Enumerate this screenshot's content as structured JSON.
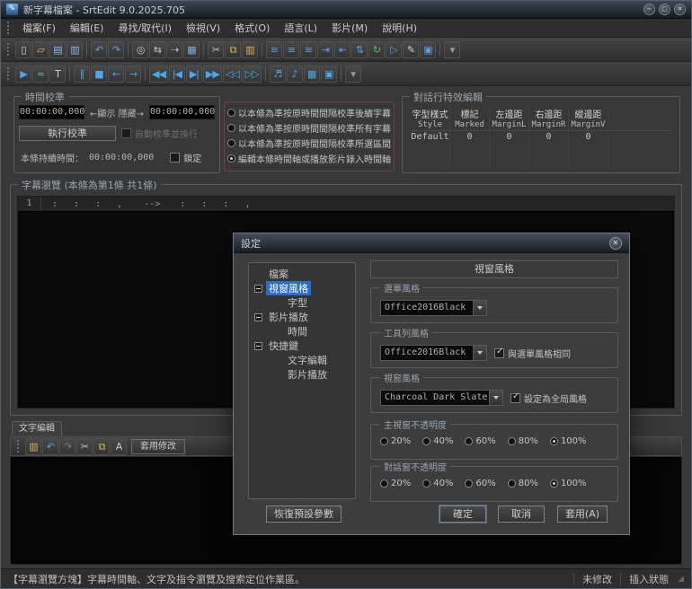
{
  "colors": {
    "selection_blue": "#2a6cc8",
    "icon_blue": "#4aa8e8",
    "titlebar_top": "#3e4754",
    "field_black": "#000000"
  },
  "window": {
    "title": "新字幕檔案 - SrtEdit 9.0.2025.705",
    "icon_glyph": "✎",
    "controls": [
      {
        "name": "minimize-button",
        "glyph": "−"
      },
      {
        "name": "maximize-button",
        "glyph": "□"
      },
      {
        "name": "close-button",
        "glyph": "✕"
      }
    ]
  },
  "menubar": {
    "items": [
      {
        "name": "menu-file",
        "label": "檔案(F)"
      },
      {
        "name": "menu-edit",
        "label": "編輯(E)"
      },
      {
        "name": "menu-find-replace",
        "label": "尋找/取代(I)"
      },
      {
        "name": "menu-view",
        "label": "檢視(V)"
      },
      {
        "name": "menu-format",
        "label": "格式(O)"
      },
      {
        "name": "menu-language",
        "label": "語言(L)"
      },
      {
        "name": "menu-movie",
        "label": "影片(M)"
      },
      {
        "name": "menu-help",
        "label": "說明(H)"
      }
    ]
  },
  "toolbar_main": {
    "icons": [
      {
        "name": "new-file-icon",
        "glyph": "▯",
        "color": "#dcdfe3"
      },
      {
        "name": "open-folder-icon",
        "glyph": "▱",
        "color": "#d8b85a"
      },
      {
        "name": "save-icon",
        "glyph": "▤",
        "color": "#8fb8e8"
      },
      {
        "name": "save-as-icon",
        "glyph": "▥",
        "color": "#8fb8e8"
      },
      {
        "sep": "true"
      },
      {
        "name": "undo-icon",
        "glyph": "↶",
        "color": "#6aa0e0"
      },
      {
        "name": "redo-icon",
        "glyph": "↷",
        "color": "#6aa0e0"
      },
      {
        "sep": "true"
      },
      {
        "name": "find-icon",
        "glyph": "◎",
        "color": "#c8c8c8"
      },
      {
        "name": "replace-icon",
        "glyph": "⇆",
        "color": "#c8c8c8"
      },
      {
        "name": "find-next-icon",
        "glyph": "⇢",
        "color": "#c8c8c8"
      },
      {
        "name": "video-preview-icon",
        "glyph": "▦",
        "color": "#7fb0d8"
      },
      {
        "sep": "true"
      },
      {
        "name": "cut-icon",
        "glyph": "✂",
        "color": "#c8c8c8"
      },
      {
        "name": "copy-icon",
        "glyph": "⧉",
        "color": "#d8b85a"
      },
      {
        "name": "paste-icon",
        "glyph": "▥",
        "color": "#d8b85a"
      },
      {
        "sep": "true"
      },
      {
        "name": "align-left-icon",
        "glyph": "≡",
        "color": "#5a9fe0"
      },
      {
        "name": "align-center-icon",
        "glyph": "≡",
        "color": "#5a9fe0"
      },
      {
        "name": "align-right-icon",
        "glyph": "≡",
        "color": "#5a9fe0"
      },
      {
        "name": "indent-icon",
        "glyph": "⇥",
        "color": "#5a9fe0"
      },
      {
        "name": "outdent-icon",
        "glyph": "⇤",
        "color": "#5a9fe0"
      },
      {
        "name": "sort-icon",
        "glyph": "⇅",
        "color": "#5a9fe0"
      },
      {
        "name": "refresh-icon",
        "glyph": "↻",
        "color": "#5ac06a"
      },
      {
        "name": "play-doc-icon",
        "glyph": "▷",
        "color": "#5a9fe0"
      },
      {
        "name": "edit-pencil-icon",
        "glyph": "✎",
        "color": "#d0d0d0"
      },
      {
        "name": "preview-window-icon",
        "glyph": "▣",
        "color": "#5a9fe0"
      },
      {
        "sep": "true"
      },
      {
        "name": "toolbar-overflow-icon",
        "glyph": "▾",
        "color": "#a0a0a0"
      }
    ]
  },
  "toolbar_play": {
    "icons": [
      {
        "name": "play-icon",
        "glyph": "▶",
        "color": "#4aa8e8"
      },
      {
        "name": "waveform-icon",
        "glyph": "≈",
        "color": "#5ac06a"
      },
      {
        "name": "text-tool-icon",
        "glyph": "T",
        "color": "#d0d0d0"
      },
      {
        "sep": "true"
      },
      {
        "name": "pause-icon",
        "glyph": "∥",
        "color": "#4aa8e8"
      },
      {
        "name": "stop-icon",
        "glyph": "■",
        "color": "#4aa8e8"
      },
      {
        "name": "step-back-icon",
        "glyph": "←",
        "color": "#4aa8e8"
      },
      {
        "name": "step-forward-icon",
        "glyph": "→",
        "color": "#4aa8e8"
      },
      {
        "sep": "true"
      },
      {
        "name": "first-subtitle-icon",
        "glyph": "◀◀",
        "color": "#4aa8e8"
      },
      {
        "name": "prev-subtitle-icon",
        "glyph": "|◀",
        "color": "#4aa8e8"
      },
      {
        "name": "next-subtitle-icon",
        "glyph": "▶|",
        "color": "#4aa8e8"
      },
      {
        "name": "last-subtitle-icon",
        "glyph": "▶▶",
        "color": "#4aa8e8"
      },
      {
        "name": "rewind-icon",
        "glyph": "◁◁",
        "color": "#4aa8e8"
      },
      {
        "name": "fast-forward-icon",
        "glyph": "▷▷",
        "color": "#4aa8e8"
      },
      {
        "sep": "true"
      },
      {
        "name": "mute-icon",
        "glyph": "♬",
        "color": "#4aa8e8"
      },
      {
        "name": "audio-icon",
        "glyph": "♪",
        "color": "#4aa8e8"
      },
      {
        "name": "video-window-icon",
        "glyph": "▦",
        "color": "#4aa8e8"
      },
      {
        "name": "fullscreen-icon",
        "glyph": "▣",
        "color": "#4aa8e8"
      },
      {
        "sep": "true"
      },
      {
        "name": "toolbar-overflow-icon",
        "glyph": "▾",
        "color": "#a0a0a0"
      }
    ]
  },
  "time_panel": {
    "title": "時間校準",
    "show_time": "00:00:00,000",
    "arrow_labels": "←顯示 隱藏→",
    "hide_time": "00:00:00,000",
    "calibrate_button": "執行校準",
    "auto_wrap_checkbox": "自動校準並換行",
    "duration_label": "本條持續時間：",
    "duration_value": "00:00:00,000",
    "lock_checkbox": "鎖定"
  },
  "calibration_modes": {
    "options": [
      {
        "name": "radio-calibrate-following",
        "label": "以本條為準按原時間間隔校準後續字幕",
        "checked": ""
      },
      {
        "name": "radio-calibrate-all",
        "label": "以本條為準按原時間間隔校準所有字幕",
        "checked": ""
      },
      {
        "name": "radio-calibrate-selection",
        "label": "以本條為準按原時間間隔校準所選區間",
        "checked": ""
      },
      {
        "name": "radio-edit-timeline",
        "label": "編輯本條時間軸或播放影片錄入時間軸",
        "checked": "true"
      }
    ]
  },
  "effects_panel": {
    "title": "對話行特效編輯",
    "columns": [
      {
        "l1": "字型樣式",
        "l2": "Style"
      },
      {
        "l1": "標記",
        "l2": "Marked"
      },
      {
        "l1": "左邊距",
        "l2": "MarginL"
      },
      {
        "l1": "右邊距",
        "l2": "MarginR"
      },
      {
        "l1": "縱邊距",
        "l2": "MarginV"
      }
    ],
    "row": [
      {
        "value": "Default"
      },
      {
        "value": "0"
      },
      {
        "value": "0"
      },
      {
        "value": "0"
      },
      {
        "value": "0"
      }
    ]
  },
  "subtitle_panel": {
    "title": "字幕瀏覽 (本條為第1條  共1條)",
    "row_number": "1",
    "time_in": ":  :  :  ,",
    "arrow": "-->",
    "time_out": ":  :  :  ,"
  },
  "text_panel": {
    "tab": "文字編輯",
    "icons": [
      {
        "name": "paste-text-icon",
        "glyph": "▥",
        "color": "#d8b85a"
      },
      {
        "name": "undo-icon",
        "glyph": "↶",
        "color": "#6aa0e0"
      },
      {
        "name": "redo-icon",
        "glyph": "↷",
        "color": "#6e7e8e"
      },
      {
        "name": "cut-icon",
        "glyph": "✂",
        "color": "#c8c8c8"
      },
      {
        "name": "copy-icon",
        "glyph": "⧉",
        "color": "#d8b85a"
      },
      {
        "name": "format-icon",
        "glyph": "A",
        "color": "#c8c8c8"
      }
    ],
    "apply_button": "套用修改"
  },
  "statusbar": {
    "left": "【字幕瀏覽方塊】字幕時間軸、文字及指令瀏覽及搜索定位作業區。",
    "modified": "未修改",
    "insert_mode": "插入狀態",
    "grip": "◢"
  },
  "settings_dialog": {
    "title": "設定",
    "close_glyph": "✕",
    "tree": [
      {
        "name": "tree-item-files",
        "label": "檔案",
        "level": 0,
        "toggle": "",
        "selected": ""
      },
      {
        "name": "tree-item-window-style",
        "label": "視窗風格",
        "level": 0,
        "toggle": "true",
        "selected": "true"
      },
      {
        "name": "tree-item-font",
        "label": "字型",
        "level": 1,
        "toggle": "",
        "selected": ""
      },
      {
        "name": "tree-item-video-playback",
        "label": "影片播放",
        "level": 0,
        "toggle": "true",
        "selected": ""
      },
      {
        "name": "tree-item-time",
        "label": "時間",
        "level": 1,
        "toggle": "",
        "selected": ""
      },
      {
        "name": "tree-item-hotkeys",
        "label": "快捷鍵",
        "level": 0,
        "toggle": "true",
        "selected": ""
      },
      {
        "name": "tree-item-hotkey-text-edit",
        "label": "文字編輯",
        "level": 1,
        "toggle": "",
        "selected": ""
      },
      {
        "name": "tree-item-hotkey-video-play",
        "label": "影片播放",
        "level": 1,
        "toggle": "",
        "selected": ""
      }
    ],
    "header": "視窗風格",
    "menu_style": {
      "legend": "選單風格",
      "value": "Office2016Black"
    },
    "toolbar_style": {
      "legend": "工具列風格",
      "value": "Office2016Black",
      "same_as_menu": "與選單風格相同"
    },
    "window_style": {
      "legend": "視窗風格",
      "value": "Charcoal Dark Slate",
      "set_global": "設定為全局風格"
    },
    "main_opacity": {
      "legend": "主視窗不透明度",
      "options": [
        {
          "name": "main-opacity-20",
          "label": "20%",
          "checked": ""
        },
        {
          "name": "main-opacity-40",
          "label": "40%",
          "checked": ""
        },
        {
          "name": "main-opacity-60",
          "label": "60%",
          "checked": ""
        },
        {
          "name": "main-opacity-80",
          "label": "80%",
          "checked": ""
        },
        {
          "name": "main-opacity-100",
          "label": "100%",
          "checked": "true"
        }
      ]
    },
    "dialog_opacity": {
      "legend": "對話窗不透明度",
      "options": [
        {
          "name": "dialog-opacity-20",
          "label": "20%",
          "checked": ""
        },
        {
          "name": "dialog-opacity-40",
          "label": "40%",
          "checked": ""
        },
        {
          "name": "dialog-opacity-60",
          "label": "60%",
          "checked": ""
        },
        {
          "name": "dialog-opacity-80",
          "label": "80%",
          "checked": ""
        },
        {
          "name": "dialog-opacity-100",
          "label": "100%",
          "checked": "true"
        }
      ]
    },
    "reset_button": "恢復預設參數",
    "ok_button": "確定",
    "cancel_button": "取消",
    "apply_button": "套用(A)"
  }
}
